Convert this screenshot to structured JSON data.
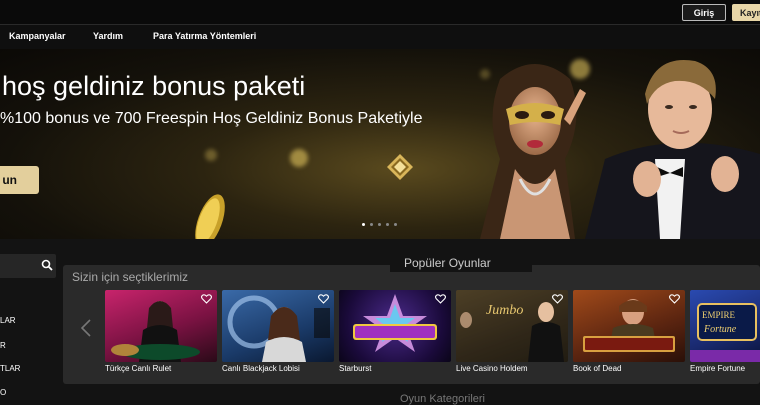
{
  "topbar": {
    "login_label": "Giriş",
    "register_label": "Kayıt Ol"
  },
  "nav": {
    "items": [
      "Kampanyalar",
      "Yardım",
      "Para Yatırma Yöntemleri"
    ]
  },
  "hero": {
    "title": "hoş geldiniz bonus paketi",
    "subtitle": "%100 bonus ve 700 Freespin Hoş Geldiniz Bonus Paketiyle",
    "cta_label": "un",
    "slide_count": 5,
    "active_slide": 1
  },
  "sidebar": {
    "items": [
      "LAR",
      "R",
      "TLAR",
      "O"
    ]
  },
  "popular": {
    "title": "Popüler Oyunlar",
    "section_title": "Sizin için seçtiklerimiz",
    "games": [
      {
        "name": "Türkçe Canlı Rulet",
        "art": "roulette"
      },
      {
        "name": "Canlı Blackjack Lobisi",
        "art": "blackjack"
      },
      {
        "name": "Starburst",
        "art": "starburst"
      },
      {
        "name": "Live Casino Holdem",
        "art": "holdem"
      },
      {
        "name": "Book of Dead",
        "art": "bookofdead"
      },
      {
        "name": "Empire Fortune",
        "art": "empire"
      }
    ]
  },
  "bottom": {
    "title": "Oyun Kategorileri"
  },
  "colors": {
    "accent_gold": "#e3cf9c",
    "panel_bg": "#2a2a2a",
    "page_bg": "#131313"
  },
  "icons": {
    "search": "search-icon",
    "heart": "heart-icon",
    "arrow": "chevron-left-icon"
  }
}
